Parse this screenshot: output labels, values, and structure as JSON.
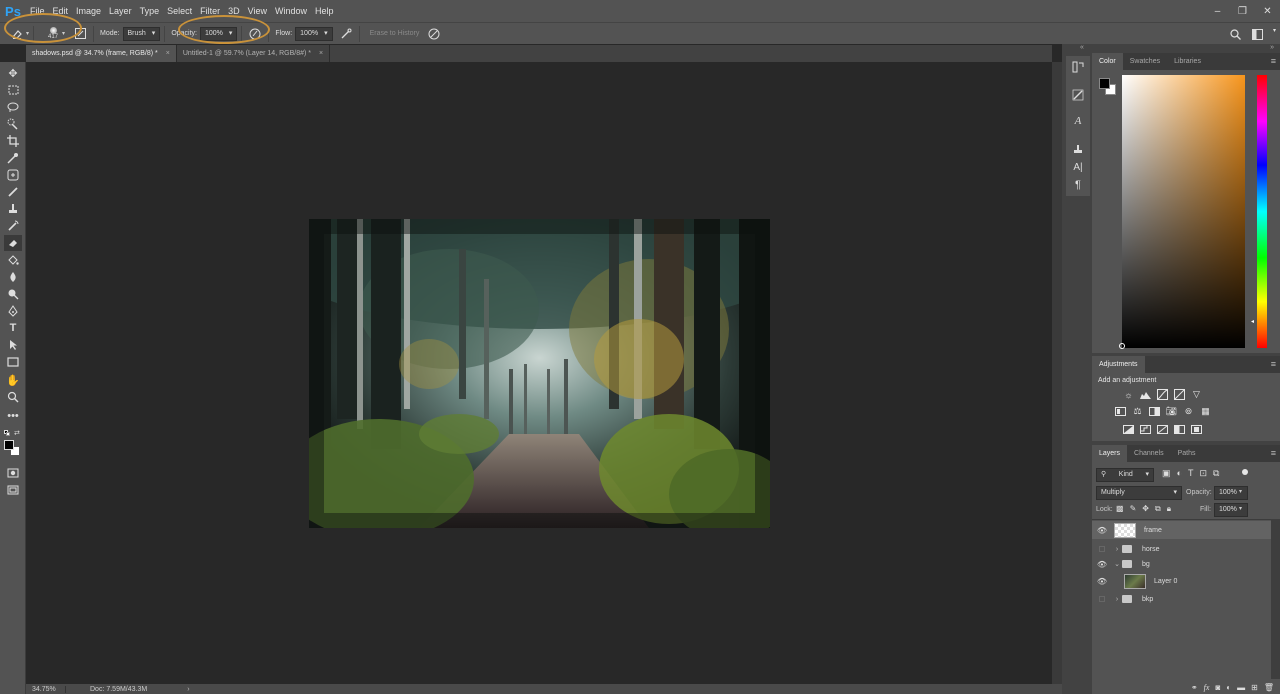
{
  "app": {
    "logo": "Ps"
  },
  "menu": [
    "File",
    "Edit",
    "Image",
    "Layer",
    "Type",
    "Select",
    "Filter",
    "3D",
    "View",
    "Window",
    "Help"
  ],
  "window_controls": [
    "–",
    "❐",
    "✕"
  ],
  "options": {
    "brush_size": "417",
    "mode_label": "Mode:",
    "mode_value": "Brush",
    "opacity_label": "Opacity:",
    "opacity_value": "100%",
    "flow_label": "Flow:",
    "flow_value": "100%",
    "erase_history": "Erase to History"
  },
  "tabs": [
    {
      "label": "shadows.psd @ 34.7% (frame, RGB/8) *",
      "close": "×"
    },
    {
      "label": "Untitled-1 @ 59.7% (Layer 14, RGB/8#) *",
      "close": "×"
    }
  ],
  "status": {
    "zoom": "34.75%",
    "doc": "Doc: 7.59M/43.3M"
  },
  "color_panel": {
    "tabs": [
      "Color",
      "Swatches",
      "Libraries"
    ],
    "accent": "#f7951c"
  },
  "adjustments": {
    "title": "Adjustments",
    "subtitle": "Add an adjustment"
  },
  "layers_panel": {
    "tabs": [
      "Layers",
      "Channels",
      "Paths"
    ],
    "filter_kind": "Kind",
    "blend_mode": "Multiply",
    "opacity_label": "Opacity:",
    "opacity_value": "100%",
    "lock_label": "Lock:",
    "fill_label": "Fill:",
    "fill_value": "100%",
    "layers": [
      {
        "name": "frame",
        "visible": true,
        "type": "layer",
        "selected": true
      },
      {
        "name": "horse",
        "visible": false,
        "type": "group"
      },
      {
        "name": "bg",
        "visible": true,
        "type": "group",
        "expanded": true
      },
      {
        "name": "Layer 0",
        "visible": true,
        "type": "layer",
        "indent": true
      },
      {
        "name": "bkp",
        "visible": false,
        "type": "group"
      }
    ]
  }
}
